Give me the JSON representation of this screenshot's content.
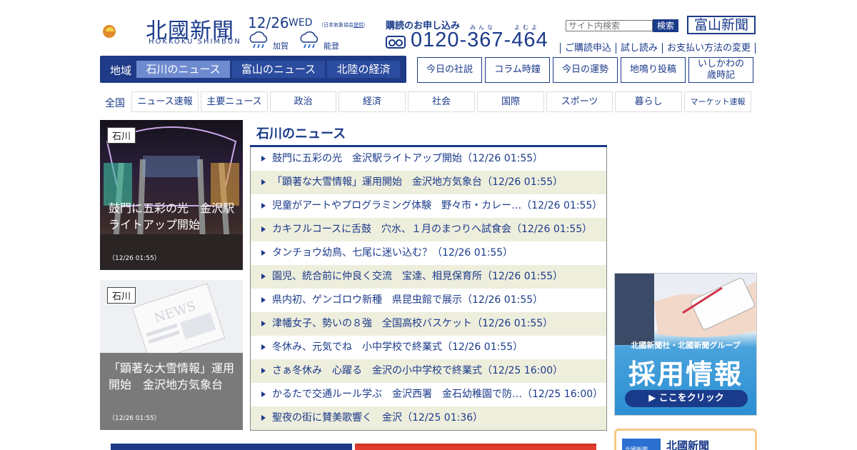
{
  "brand": {
    "name": "北國新聞",
    "romaji": "HOKKOKU SHIMBUN"
  },
  "date": {
    "day": "12/26",
    "weekday": "WED",
    "source_prefix": "（日本気象協会",
    "source_link": "提供",
    "source_suffix": "）"
  },
  "weather": [
    {
      "area": "加賀",
      "icon": "rain-cloud-icon"
    },
    {
      "area": "能登",
      "icon": "rain-cloud-icon"
    }
  ],
  "subscription": {
    "label": "購読のお申し込み",
    "ruby_1": "みんな",
    "ruby_2": "よむよ",
    "phone": "0120-367-464"
  },
  "search": {
    "placeholder": "サイト内検索",
    "button": "検索"
  },
  "toyama_link": "富山新聞",
  "sub_links": [
    "ご購読申込",
    "試し読み",
    "お支払い方法の変更"
  ],
  "region_nav": {
    "label": "地域",
    "tabs": [
      "石川のニュース",
      "富山のニュース",
      "北陸の経済"
    ],
    "active_index": 0
  },
  "feature_buttons": [
    "今日の社説",
    "コラム時鐘",
    "今日の運勢",
    "地鳴り投稿",
    "いしかわの\n歳時記"
  ],
  "categories": {
    "label": "全国",
    "items": [
      "ニュース速報",
      "主要ニュース",
      "政治",
      "経済",
      "社会",
      "国際",
      "スポーツ",
      "暮らし",
      "マーケット速報"
    ]
  },
  "features": [
    {
      "tag": "石川",
      "caption": "鼓門に五彩の光　金沢駅ライトアップ開始",
      "time": "（12/26 01:55）"
    },
    {
      "tag": "石川",
      "caption": "「顕著な大雪情報」運用開始　金沢地方気象台",
      "time": "（12/26 01:55）"
    }
  ],
  "news": {
    "title": "石川のニュース",
    "items": [
      "鼓門に五彩の光　金沢駅ライトアップ開始（12/26 01:55）",
      "「顕著な大雪情報」運用開始　金沢地方気象台（12/26 01:55）",
      "児童がアートやプログラミング体験　野々市・カレー…（12/26 01:55）",
      "カキフルコースに舌鼓　穴水、１月のまつりへ試食会（12/26 01:55）",
      "タンチョウ幼鳥、七尾に迷い込む？（12/26 01:55）",
      "園児、統合前に仲良く交流　宝達、相見保育所（12/26 01:55）",
      "県内初、ゲンゴロウ新種　県昆虫館で展示（12/26 01:55）",
      "津幡女子、勢いの８強　全国高校バスケット（12/26 01:55）",
      "冬休み、元気でね　小中学校で終業式（12/26 01:55）",
      "さぁ冬休み　心躍る　金沢の小中学校で終業式（12/25 16:00）",
      "かるたで交通ルール学ぶ　金沢西署　金石幼稚園で防…（12/25 16:00）",
      "聖夜の街に賛美歌響く　金沢（12/25 01:36）"
    ]
  },
  "ad": {
    "line1": "北國新聞社・北國新聞グループ",
    "line2": "採用情報",
    "button": "▶ ここをクリック"
  },
  "side_card": {
    "title": "北國新聞",
    "logo_text": "北國新聞"
  },
  "colors": {
    "brand_navy": "#1a3a8a",
    "alt_row": "#eeeedd",
    "active_tab": "#6f8bd0"
  }
}
